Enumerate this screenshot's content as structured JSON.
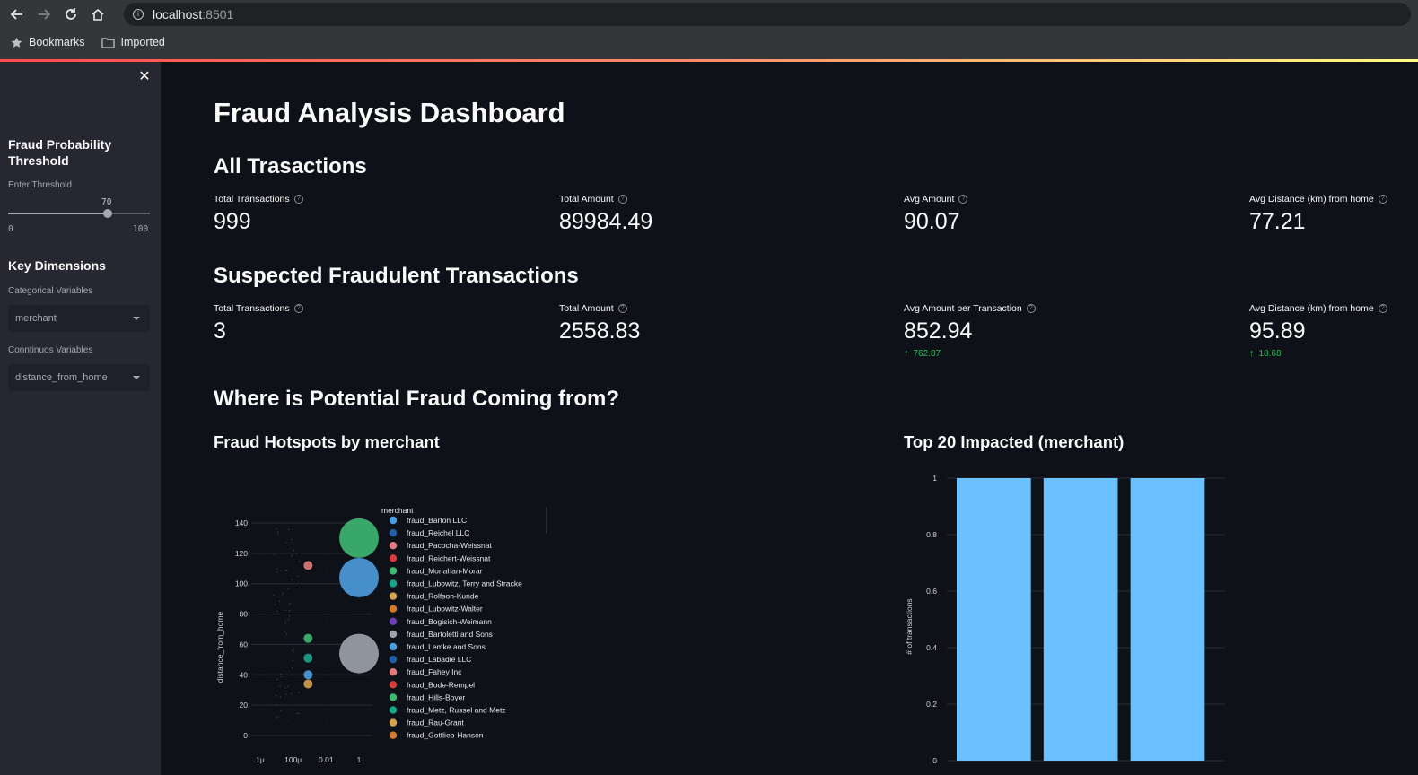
{
  "browser": {
    "url_host": "localhost",
    "url_port": ":8501",
    "bookmarks": [
      {
        "label": "Bookmarks",
        "icon": "star-icon"
      },
      {
        "label": "Imported",
        "icon": "folder-icon"
      }
    ]
  },
  "sidebar": {
    "threshold_heading": "Fraud Probability Threshold",
    "threshold_label": "Enter Threshold",
    "slider": {
      "value": 70,
      "min": 0,
      "max": 100,
      "value_text": "70",
      "min_text": "0",
      "max_text": "100"
    },
    "key_dimensions_heading": "Key Dimensions",
    "categorical_label": "Categorical Variables",
    "categorical_value": "merchant",
    "continuous_label": "Conntinuos Variables",
    "continuous_value": "distance_from_home"
  },
  "main": {
    "title": "Fraud Analysis Dashboard",
    "all_heading": "All Trasactions",
    "all_metrics": [
      {
        "label": "Total Transactions",
        "value": "999"
      },
      {
        "label": "Total Amount",
        "value": "89984.49"
      },
      {
        "label": "Avg Amount",
        "value": "90.07"
      },
      {
        "label": "Avg Distance (km) from home",
        "value": "77.21"
      }
    ],
    "fraud_heading": "Suspected Fraudulent Transactions",
    "fraud_metrics": [
      {
        "label": "Total Transactions",
        "value": "3",
        "delta": ""
      },
      {
        "label": "Total Amount",
        "value": "2558.83",
        "delta": ""
      },
      {
        "label": "Avg Amount per Transaction",
        "value": "852.94",
        "delta": "762.87"
      },
      {
        "label": "Avg Distance (km) from home",
        "value": "95.89",
        "delta": "18.68"
      }
    ],
    "where_heading": "Where is Potential Fraud Coming from?",
    "hotspots_heading": "Fraud Hotspots by merchant",
    "top20_heading": "Top 20 Impacted (merchant)"
  },
  "chart_data": [
    {
      "type": "scatter",
      "ylabel": "distance_from_home",
      "xlabel": "",
      "x_scale": "log",
      "x_ticks": [
        "1μ",
        "100μ",
        "0.01",
        "1"
      ],
      "x_tick_values": [
        1e-06,
        0.0001,
        0.01,
        1
      ],
      "y_ticks": [
        "0",
        "20",
        "40",
        "60",
        "80",
        "100",
        "120",
        "140"
      ],
      "ylim": [
        0,
        140
      ],
      "legend_title": "merchant",
      "legend_placement": "right",
      "bubbles": [
        {
          "x": 1,
          "y": 130,
          "size": 22,
          "color": "#3fb873"
        },
        {
          "x": 1,
          "y": 104,
          "size": 22,
          "color": "#4c9ddf"
        },
        {
          "x": 1,
          "y": 54,
          "size": 22,
          "color": "#9ea3ad"
        },
        {
          "x": 0.01,
          "y": 112,
          "size": 5,
          "color": "#e07b7b"
        },
        {
          "x": 0.01,
          "y": 64,
          "size": 5,
          "color": "#3fb873"
        },
        {
          "x": 0.01,
          "y": 51,
          "size": 5,
          "color": "#17a589"
        },
        {
          "x": 0.01,
          "y": 40,
          "size": 5,
          "color": "#4c9ddf"
        },
        {
          "x": 0.01,
          "y": 34,
          "size": 5,
          "color": "#d4a24c"
        }
      ],
      "series": [
        {
          "name": "fraud_Barton LLC",
          "color": "#4c9ddf"
        },
        {
          "name": "fraud_Reichel LLC",
          "color": "#1f5fa8"
        },
        {
          "name": "fraud_Pacocha-Weissnat",
          "color": "#e07b7b"
        },
        {
          "name": "fraud_Reichert-Weissnat",
          "color": "#d83b3b"
        },
        {
          "name": "fraud_Monahan-Morar",
          "color": "#3fb873"
        },
        {
          "name": "fraud_Lubowitz, Terry and Stracke",
          "color": "#17a589"
        },
        {
          "name": "fraud_Rolfson-Kunde",
          "color": "#d4a24c"
        },
        {
          "name": "fraud_Lubowitz-Walter",
          "color": "#d07a2e"
        },
        {
          "name": "fraud_Bogisich-Weimann",
          "color": "#6a3fb3"
        },
        {
          "name": "fraud_Bartoletti and Sons",
          "color": "#9ea3ad"
        },
        {
          "name": "fraud_Lemke and Sons",
          "color": "#4c9ddf"
        },
        {
          "name": "fraud_Labadie LLC",
          "color": "#1f5fa8"
        },
        {
          "name": "fraud_Fahey Inc",
          "color": "#e07b7b"
        },
        {
          "name": "fraud_Bode-Rempel",
          "color": "#d83b3b"
        },
        {
          "name": "fraud_Hills-Boyer",
          "color": "#3fb873"
        },
        {
          "name": "fraud_Metz, Russel and Metz",
          "color": "#17a589"
        },
        {
          "name": "fraud_Rau-Grant",
          "color": "#d4a24c"
        },
        {
          "name": "fraud_Gottlieb-Hansen",
          "color": "#d07a2e"
        }
      ]
    },
    {
      "type": "bar",
      "ylabel": "# of transactions",
      "xlabel": "",
      "categories": [
        "",
        "",
        ""
      ],
      "values": [
        1,
        1,
        1
      ],
      "ylim": [
        0,
        1
      ],
      "y_ticks": [
        "0",
        "0.2",
        "0.4",
        "0.6",
        "0.8",
        "1"
      ],
      "bar_color": "#6bc1ff",
      "grid": true
    }
  ]
}
